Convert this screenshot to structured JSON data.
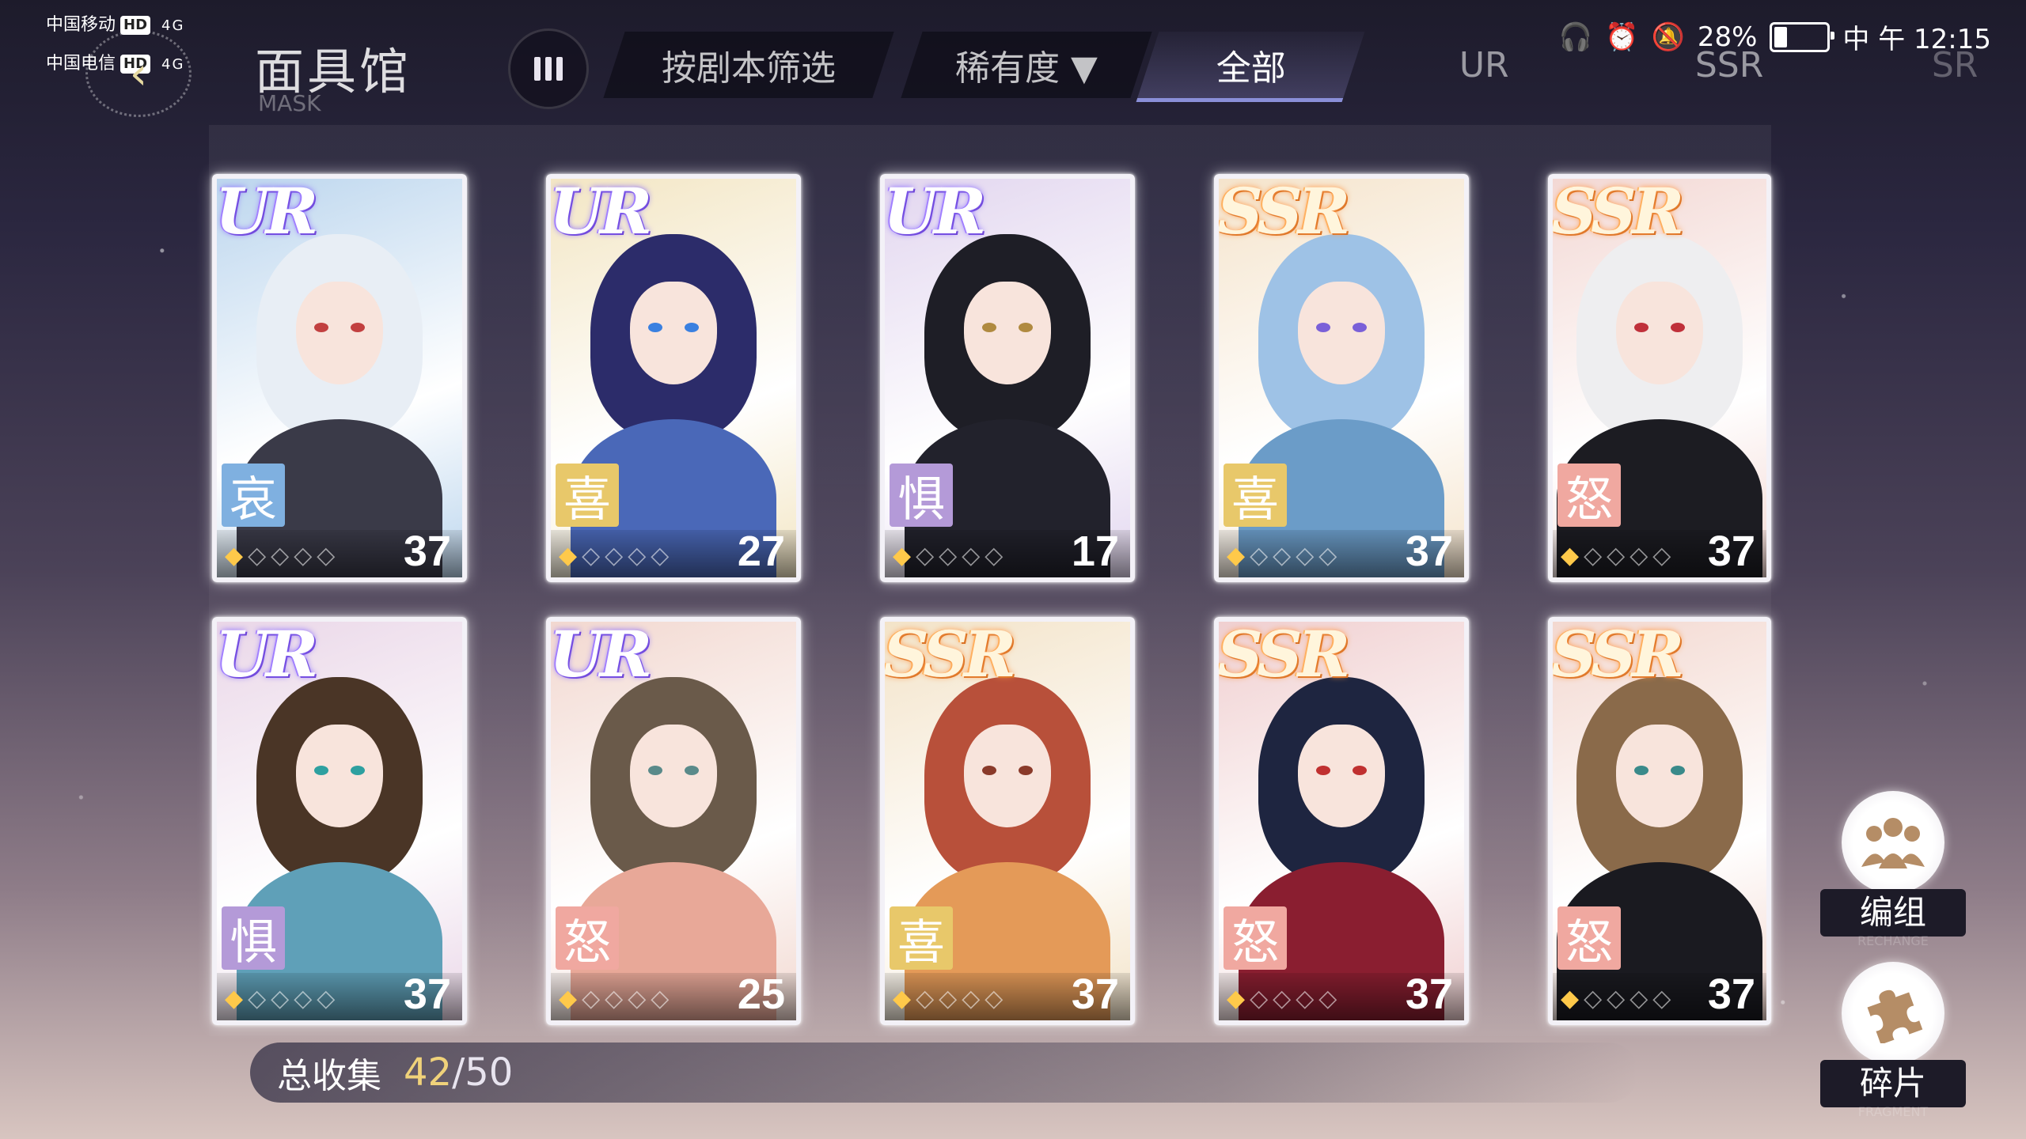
{
  "status_bar": {
    "carrier1": "中国移动",
    "carrier2": "中国电信",
    "hd": "HD",
    "net1": "4G",
    "net2": "4G",
    "battery_text": "28%",
    "battery_level": 0.28,
    "time": "中 午 12:15"
  },
  "header": {
    "title": "面具馆",
    "subtitle": "MASK",
    "tabs": [
      {
        "label": "按剧本筛选"
      },
      {
        "label": "稀有度 ▼"
      },
      {
        "label": "全部"
      },
      {
        "label": "UR"
      },
      {
        "label": "SSR"
      },
      {
        "label": "SR"
      }
    ]
  },
  "cards": [
    {
      "rarity": "UR",
      "emotion": "哀",
      "level": "37",
      "emotion_color": "#7fb0e0",
      "hair": "#e8eef5",
      "body": "#3a3a48",
      "bg": "#bcd6ee",
      "eye": "#c24040",
      "stars": 1
    },
    {
      "rarity": "UR",
      "emotion": "喜",
      "level": "27",
      "emotion_color": "#e8c86a",
      "hair": "#2c2c6a",
      "body": "#4a68b8",
      "bg": "#f3e6c4",
      "eye": "#3a80e0",
      "stars": 1
    },
    {
      "rarity": "UR",
      "emotion": "惧",
      "level": "17",
      "emotion_color": "#b49ad8",
      "hair": "#1e1e26",
      "body": "#22222c",
      "bg": "#e2d6ef",
      "eye": "#b08a40",
      "stars": 1
    },
    {
      "rarity": "SSR",
      "emotion": "喜",
      "level": "37",
      "emotion_color": "#e8c86a",
      "hair": "#9ec2e6",
      "body": "#6b9cc8",
      "bg": "#f5e4cc",
      "eye": "#7a60d8",
      "stars": 1
    },
    {
      "rarity": "SSR",
      "emotion": "怒",
      "level": "37",
      "emotion_color": "#f0a8a0",
      "hair": "#eeeef0",
      "body": "#1c1c22",
      "bg": "#f3d8d4",
      "eye": "#c0303a",
      "stars": 1
    },
    {
      "rarity": "UR",
      "emotion": "惧",
      "level": "37",
      "emotion_color": "#b49ad8",
      "hair": "#4a3526",
      "body": "#5fa0b8",
      "bg": "#ead7e8",
      "eye": "#2ea0a0",
      "stars": 1
    },
    {
      "rarity": "UR",
      "emotion": "怒",
      "level": "25",
      "emotion_color": "#f0a8a0",
      "hair": "#6a5a4a",
      "body": "#e8a898",
      "bg": "#f2d8d0",
      "eye": "#5a8a8a",
      "stars": 1
    },
    {
      "rarity": "SSR",
      "emotion": "喜",
      "level": "37",
      "emotion_color": "#e8c86a",
      "hair": "#b8503a",
      "body": "#e49a58",
      "bg": "#f3e3c8",
      "eye": "#8a3a2a",
      "stars": 1
    },
    {
      "rarity": "SSR",
      "emotion": "怒",
      "level": "37",
      "emotion_color": "#f0a8a0",
      "hair": "#1e2540",
      "body": "#8a1e30",
      "bg": "#f0cfd0",
      "eye": "#c03030",
      "stars": 1
    },
    {
      "rarity": "SSR",
      "emotion": "怒",
      "level": "37",
      "emotion_color": "#f0a8a0",
      "hair": "#8a6a4a",
      "body": "#1a1a20",
      "bg": "#f3d8d0",
      "eye": "#3a8a8a",
      "stars": 1
    }
  ],
  "collection": {
    "label": "总收集",
    "count": "42",
    "total": "/50"
  },
  "side_buttons": {
    "team_label": "编组",
    "team_sub": "RECHANGE",
    "team_icon": "group-icon",
    "fragment_label": "碎片",
    "fragment_sub": "FRAGMENT",
    "fragment_icon": "puzzle-icon"
  }
}
